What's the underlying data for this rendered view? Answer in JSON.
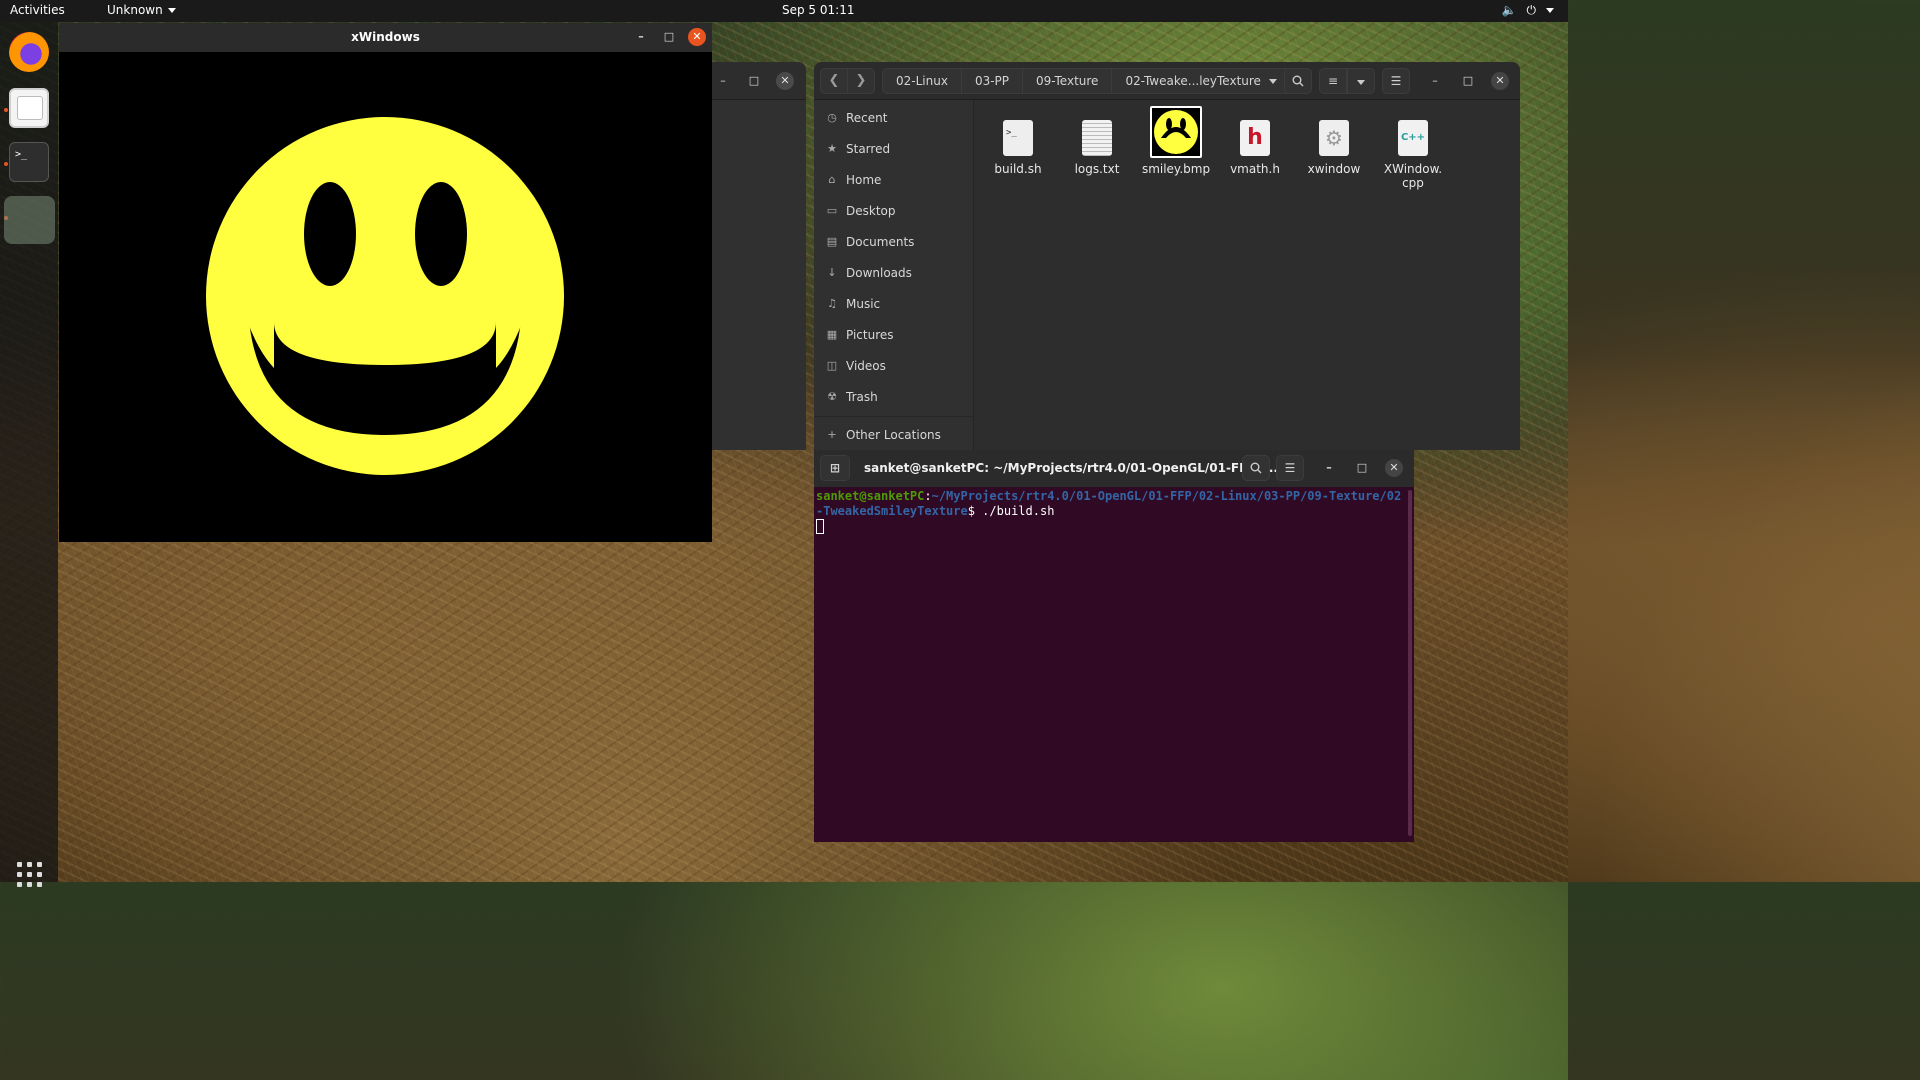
{
  "topbar": {
    "activities": "Activities",
    "app_menu": "Unknown",
    "clock": "Sep 5  01:11",
    "tray_icons": [
      "volume-icon",
      "power-icon",
      "chevron-down-icon"
    ]
  },
  "dock": {
    "items": [
      "firefox",
      "files",
      "terminal",
      "active-window"
    ],
    "terminal_glyph": ">_"
  },
  "xwindows": {
    "title": "xWindows",
    "colors": {
      "face": "#ffff3f",
      "features": "#000000",
      "background": "#000000"
    }
  },
  "file_manager": {
    "breadcrumbs": [
      "02-Linux",
      "03-PP",
      "09-Texture",
      "02-Tweake...leyTexture"
    ],
    "sidebar": [
      {
        "label": "Recent",
        "icon": "clock-icon"
      },
      {
        "label": "Starred",
        "icon": "star-icon"
      },
      {
        "label": "Home",
        "icon": "home-icon"
      },
      {
        "label": "Desktop",
        "icon": "desktop-icon"
      },
      {
        "label": "Documents",
        "icon": "document-icon"
      },
      {
        "label": "Downloads",
        "icon": "download-icon"
      },
      {
        "label": "Music",
        "icon": "music-icon"
      },
      {
        "label": "Pictures",
        "icon": "picture-icon"
      },
      {
        "label": "Videos",
        "icon": "video-icon"
      },
      {
        "label": "Trash",
        "icon": "trash-icon"
      }
    ],
    "other_locations": "Other Locations",
    "files": [
      {
        "name": "build.sh",
        "type": "script"
      },
      {
        "name": "logs.txt",
        "type": "text"
      },
      {
        "name": "smiley.bmp",
        "type": "image",
        "selected": true
      },
      {
        "name": "vmath.h",
        "type": "header",
        "glyph": "h"
      },
      {
        "name": "xwindow",
        "type": "executable"
      },
      {
        "name": "XWindow.\ncpp",
        "type": "cpp",
        "glyph": "C++"
      }
    ]
  },
  "terminal": {
    "title": "sanket@sanketPC: ~/MyProjects/rtr4.0/01-OpenGL/01-FFP/0...",
    "prompt_user": "sanket@sanketPC",
    "prompt_sep": ":",
    "prompt_path": "~/MyProjects/rtr4.0/01-OpenGL/01-FFP/02-Linux/03-PP/09-Texture/02-TweakedSmileyTexture",
    "prompt_symbol": "$ ",
    "command": "./build.sh"
  }
}
